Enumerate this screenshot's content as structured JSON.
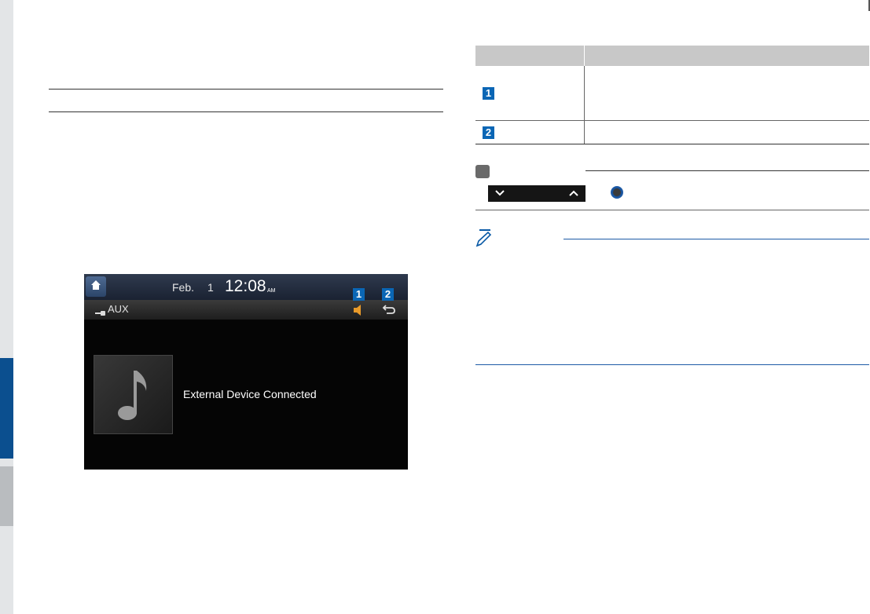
{
  "screen": {
    "date": "Feb.",
    "day": "1",
    "time": "12:08",
    "ampm": "AM",
    "source_label": "AUX",
    "message": "External Device Connected"
  },
  "callouts": [
    "1",
    "2"
  ],
  "table": {
    "rows": [
      {
        "badge": "1"
      },
      {
        "badge": "2"
      }
    ]
  },
  "icons": {
    "home": "home-icon",
    "aux": "aux-cable-icon",
    "volume": "speaker-icon",
    "back": "back-arrow-icon",
    "album": "music-note-icon",
    "chevron_down": "chevron-down-icon",
    "chevron_up": "chevron-up-icon",
    "knob": "knob-icon",
    "note": "pencil-note-icon"
  },
  "colors": {
    "accent_blue": "#0a66b5",
    "side_tab": "#0b4f8f",
    "table_header": "#c8c8c8"
  }
}
